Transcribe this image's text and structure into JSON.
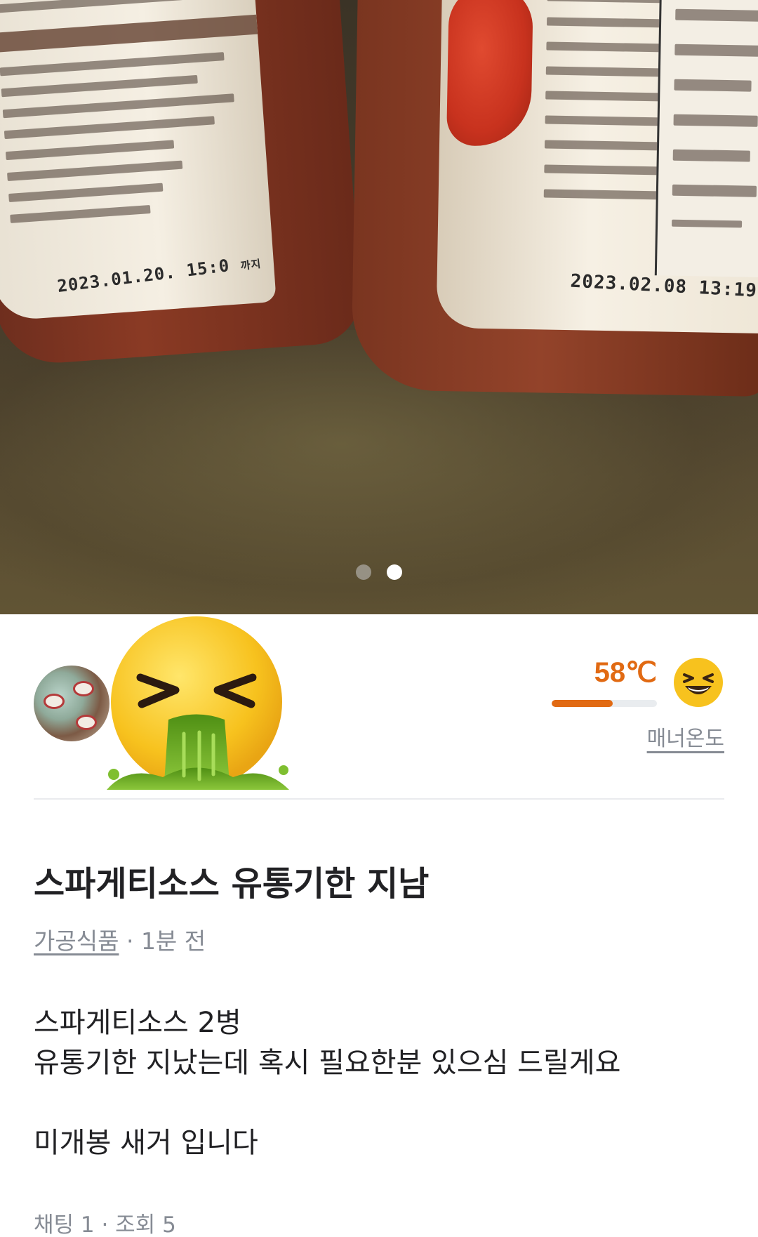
{
  "photo": {
    "left_jar_date": "2023.01.20. 15:0",
    "left_jar_date_suffix": "까지",
    "right_jar_date": "2023.02.08 13:19",
    "carousel": {
      "total": 2,
      "active_index": 1
    }
  },
  "seller": {
    "manner_temp": "58℃",
    "manner_temp_value": 58,
    "manner_label": "매너온도"
  },
  "post": {
    "title": "스파게티소스 유통기한 지남",
    "category": "가공식품",
    "separator": " · ",
    "time_ago": "1분 전",
    "body": "스파게티소스 2병\n유통기한 지났는데 혹시 필요한분 있으심 드릴게요\n\n미개봉 새거 입니다",
    "stats": "채팅 1 · 조회 5"
  },
  "colors": {
    "accent_orange": "#e16a13",
    "text_primary": "#212124",
    "text_secondary": "#868b94"
  }
}
